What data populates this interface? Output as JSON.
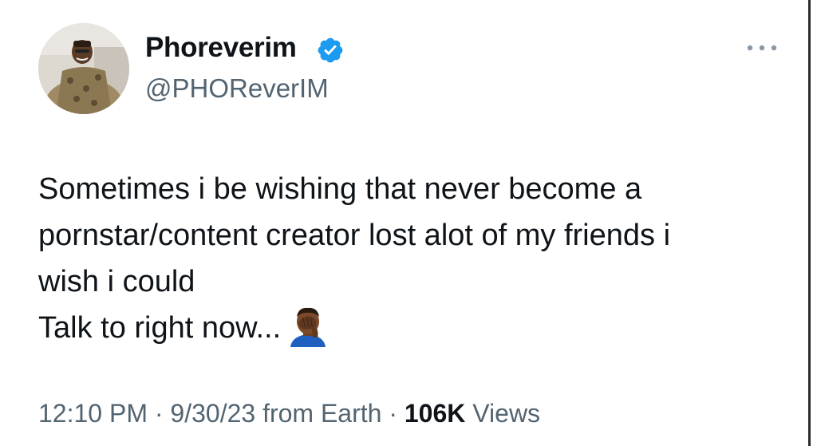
{
  "author": {
    "display_name": "Phoreverim",
    "handle": "@PHOReverIM",
    "verified": true,
    "verified_color": "#1d9bf0"
  },
  "tweet": {
    "lines": [
      "Sometimes i be wishing that never become a",
      "pornstar/content creator lost alot of my friends i",
      "wish i could",
      "Talk to right now..."
    ],
    "emoji": "face-palm-emoji"
  },
  "meta": {
    "time": "12:10 PM",
    "separator_1": " · ",
    "date": "9/30/23",
    "source": " from Earth",
    "separator_2": " · ",
    "views_count": "106K",
    "views_label": " Views"
  },
  "icons": {
    "more": "more-options-icon",
    "verified": "verified-badge-icon"
  },
  "colors": {
    "text_primary": "#0f1419",
    "text_secondary": "#536471"
  }
}
